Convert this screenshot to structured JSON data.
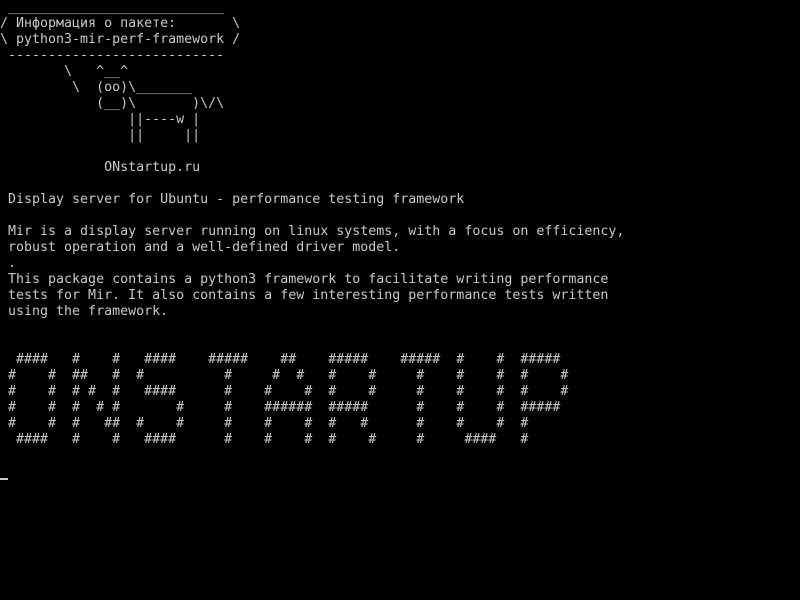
{
  "terminal": {
    "foreground": "#c8c8c8",
    "background": "#000000",
    "lines": [
      " ___________________________",
      "/ Информация о пакете:       \\",
      "\\ python3-mir-perf-framework /",
      " ---------------------------",
      "        \\   ^__^",
      "         \\  (oo)\\_______",
      "            (__)\\       )\\/\\",
      "                ||----w |",
      "                ||     ||",
      "",
      "             ONstartup.ru",
      "",
      " Display server for Ubuntu - performance testing framework",
      "",
      " Mir is a display server running on linux systems, with a focus on efficiency,",
      " robust operation and a well-defined driver model.",
      " .",
      " This package contains a python3 framework to facilitate writing performance",
      " tests for Mir. It also contains a few interesting performance tests written",
      " using the framework.",
      "",
      "",
      "  ####   #    #   ####    #####    ##    #####    #####  #    #  #####",
      " #    #  ##   #  #          #     #  #   #    #     #    #    #  #    #",
      " #    #  # #  #   ####      #    #    #  #    #     #    #    #  #    #",
      " #    #  #  # #       #     #    ######  #####      #    #    #  #####",
      " #    #  #   ##  #    #     #    #    #  #   #      #    #    #  #",
      "  ####   #    #   ####      #    #    #  #    #     #     ####   #",
      "",
      ""
    ]
  }
}
